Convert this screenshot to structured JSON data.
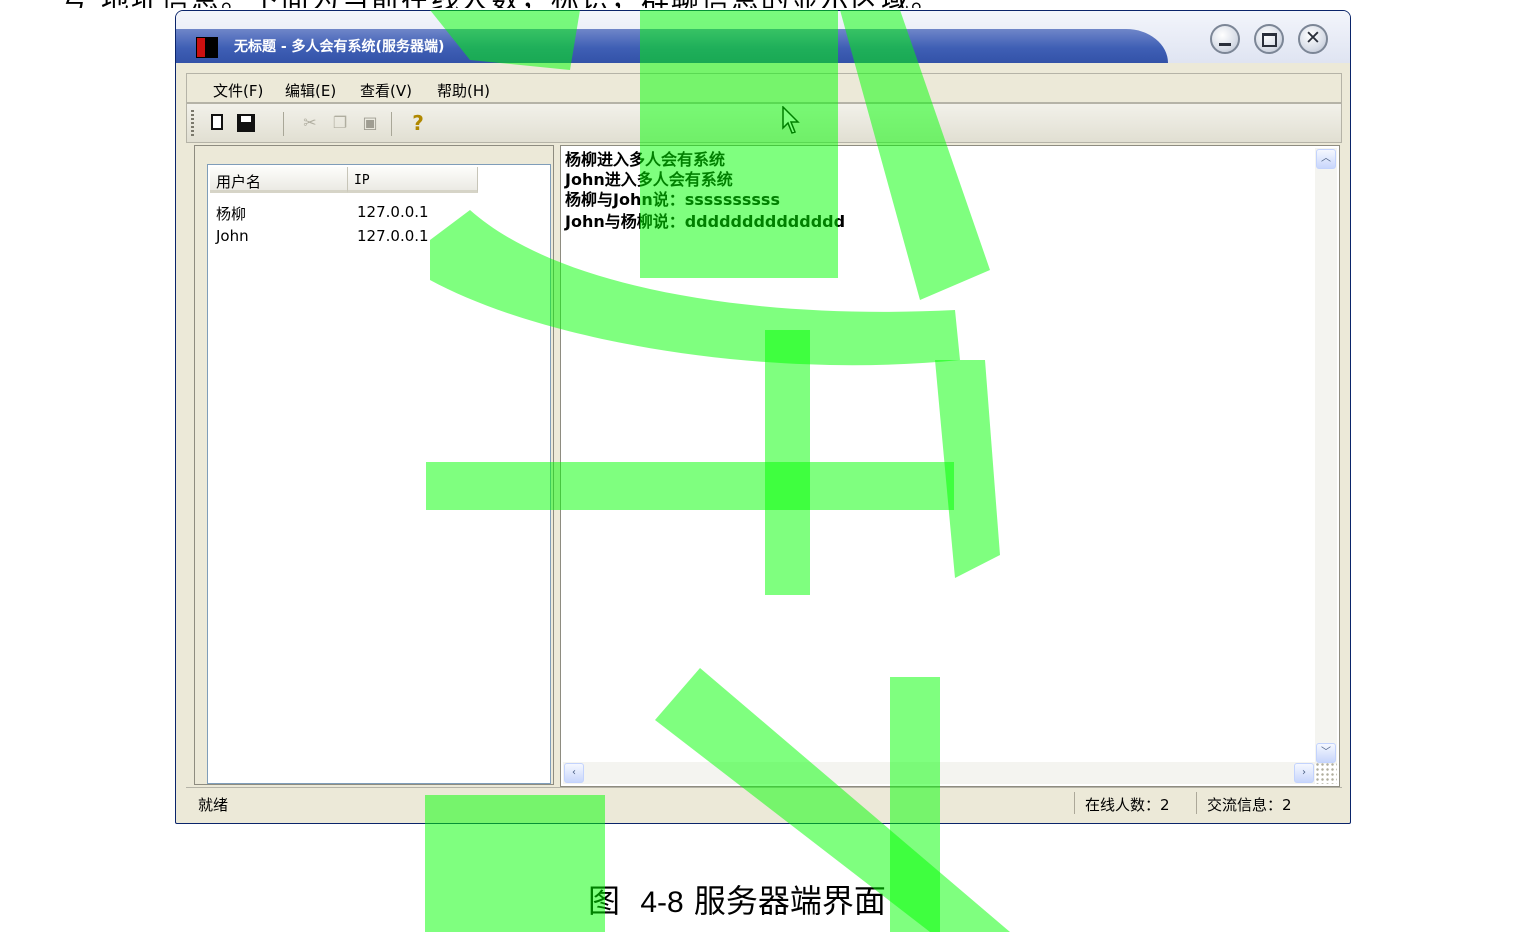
{
  "page_top_text": "号      地址信息。下面为当前在线人数，标识，群聊信息的显示区域。",
  "window": {
    "title": "无标题 - 多人会有系统(服务器端)"
  },
  "menu": {
    "items": [
      "文件(F)",
      "编辑(E)",
      "查看(V)",
      "帮助(H)"
    ]
  },
  "toolbar": {
    "icons": [
      "new-file-icon",
      "save-icon",
      "cut-icon",
      "copy-icon",
      "paste-icon",
      "help-icon"
    ]
  },
  "user_list": {
    "columns": [
      "用户名",
      "IP"
    ],
    "rows": [
      {
        "name": "杨柳",
        "ip": "127.0.0.1"
      },
      {
        "name": "John",
        "ip": "127.0.0.1"
      }
    ]
  },
  "chat": {
    "lines": [
      "杨柳进入多人会有系统",
      "John进入多人会有系统",
      "杨柳与John说：ssssssssss",
      "John与杨柳说：dddddddddddddd"
    ]
  },
  "status": {
    "text": "就绪",
    "online": "在线人数：2",
    "messages": "交流信息：2"
  },
  "caption": {
    "prefix": "图",
    "number": "4-8",
    "text": "服务器端界面"
  },
  "colors": {
    "title_blue": "#3f5fb5",
    "watermark_green": "#00ff00"
  }
}
